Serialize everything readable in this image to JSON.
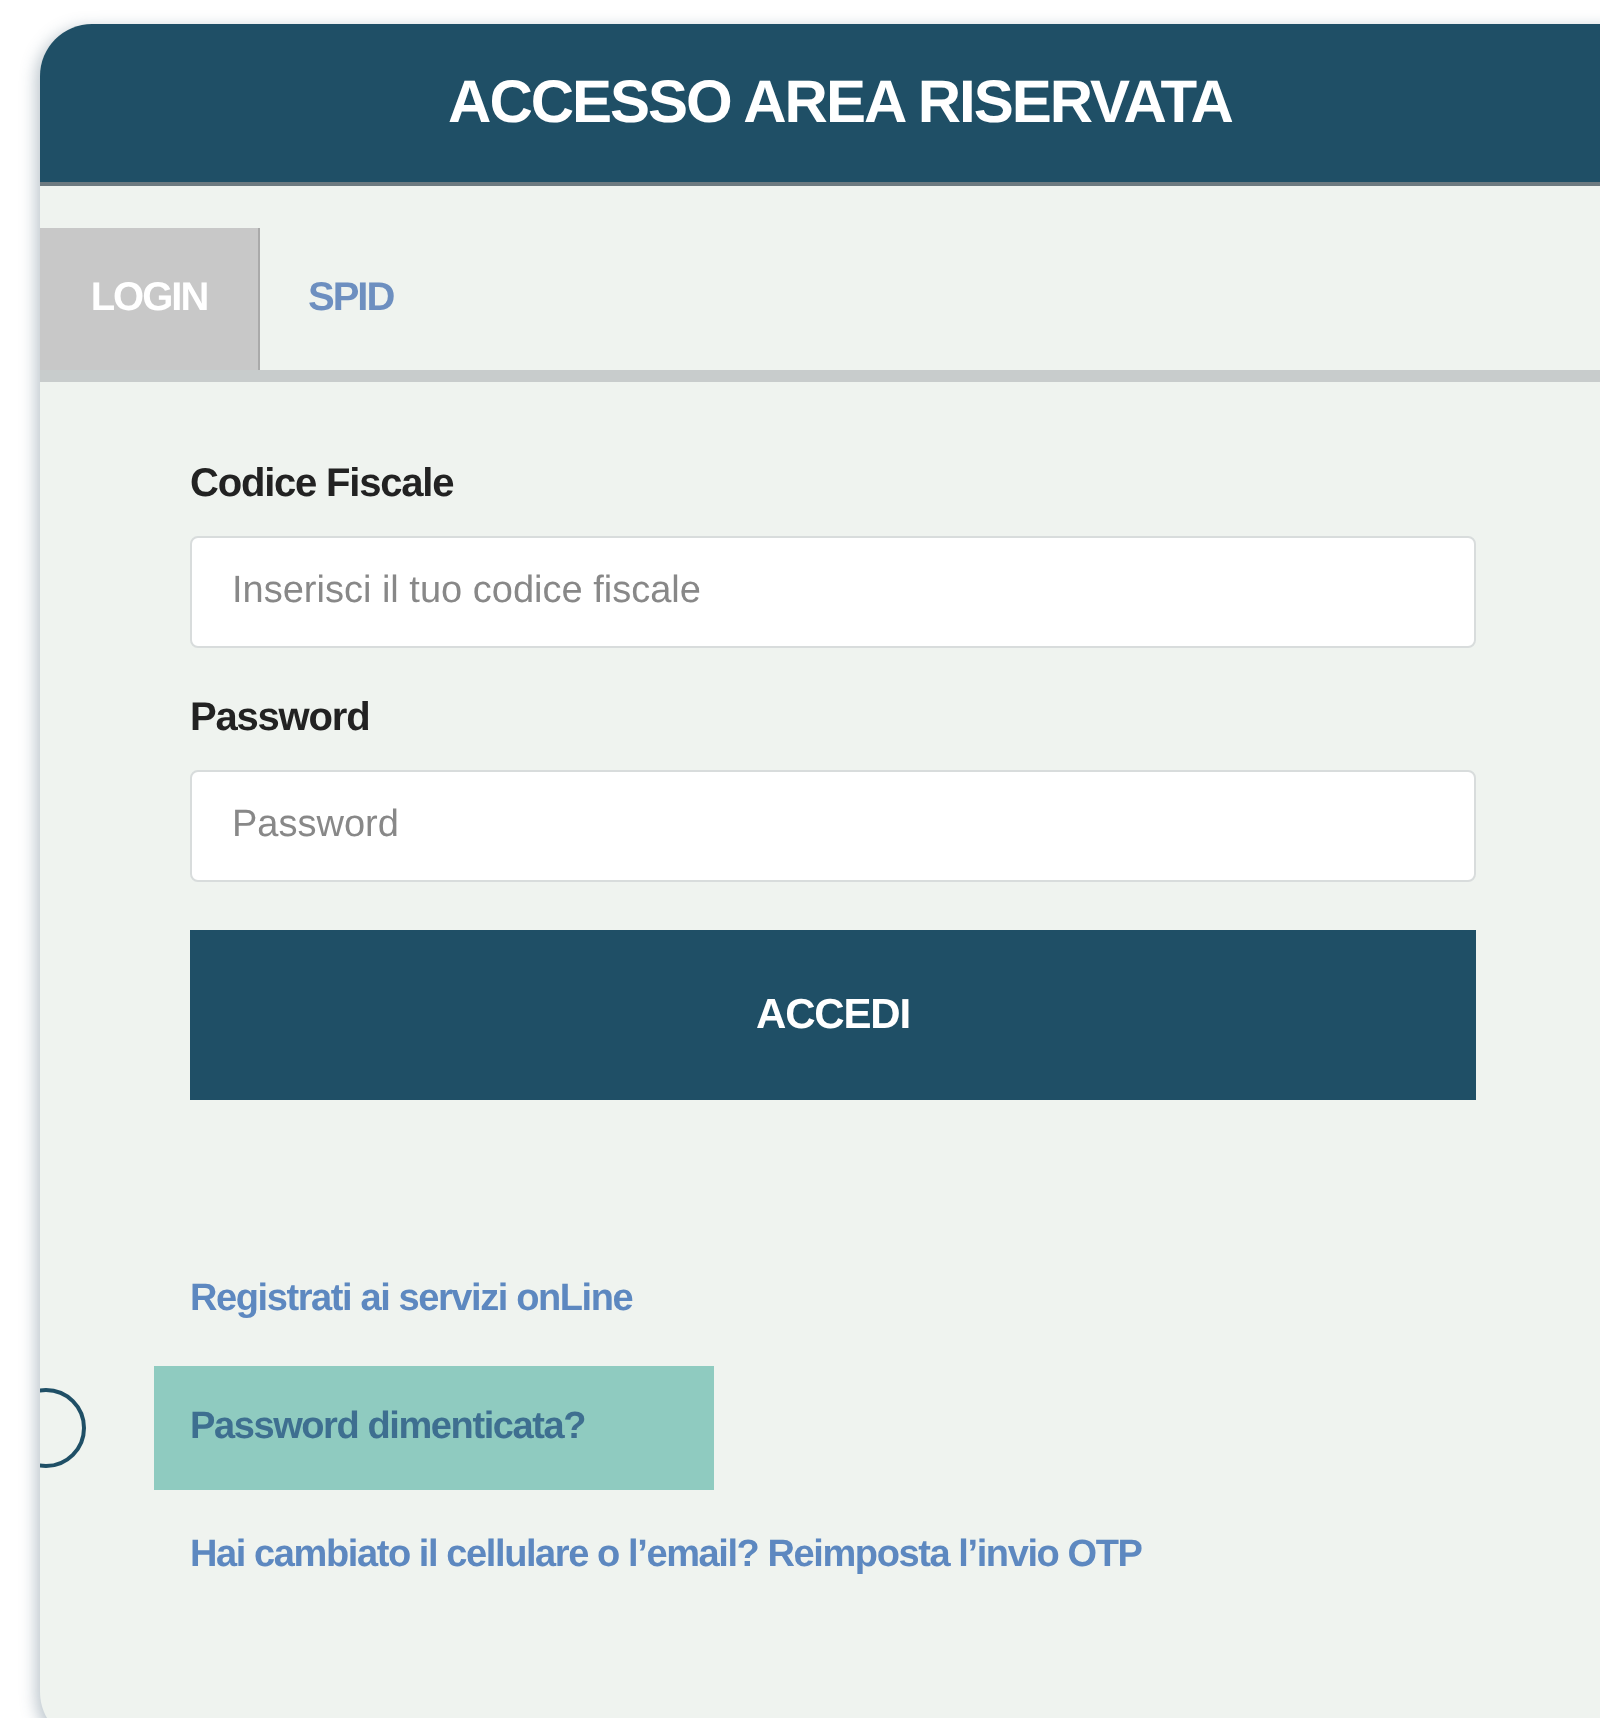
{
  "header": {
    "title": "ACCESSO AREA RISERVATA"
  },
  "tabs": [
    {
      "label": "LOGIN",
      "selected": true
    },
    {
      "label": "SPID",
      "selected": false
    }
  ],
  "fields": [
    {
      "label": "Codice Fiscale",
      "placeholder": "Inserisci il tuo codice fiscale"
    },
    {
      "label": "Password",
      "placeholder": "Password"
    }
  ],
  "submit": {
    "label": "ACCEDI"
  },
  "links": [
    {
      "label": "Registrati ai servizi onLine",
      "selected": false
    },
    {
      "label": "Password dimenticata?",
      "selected": true
    },
    {
      "label": "Hai cambiato il cellulare o l’email? Reimposta l’invio OTP",
      "selected": false
    }
  ]
}
